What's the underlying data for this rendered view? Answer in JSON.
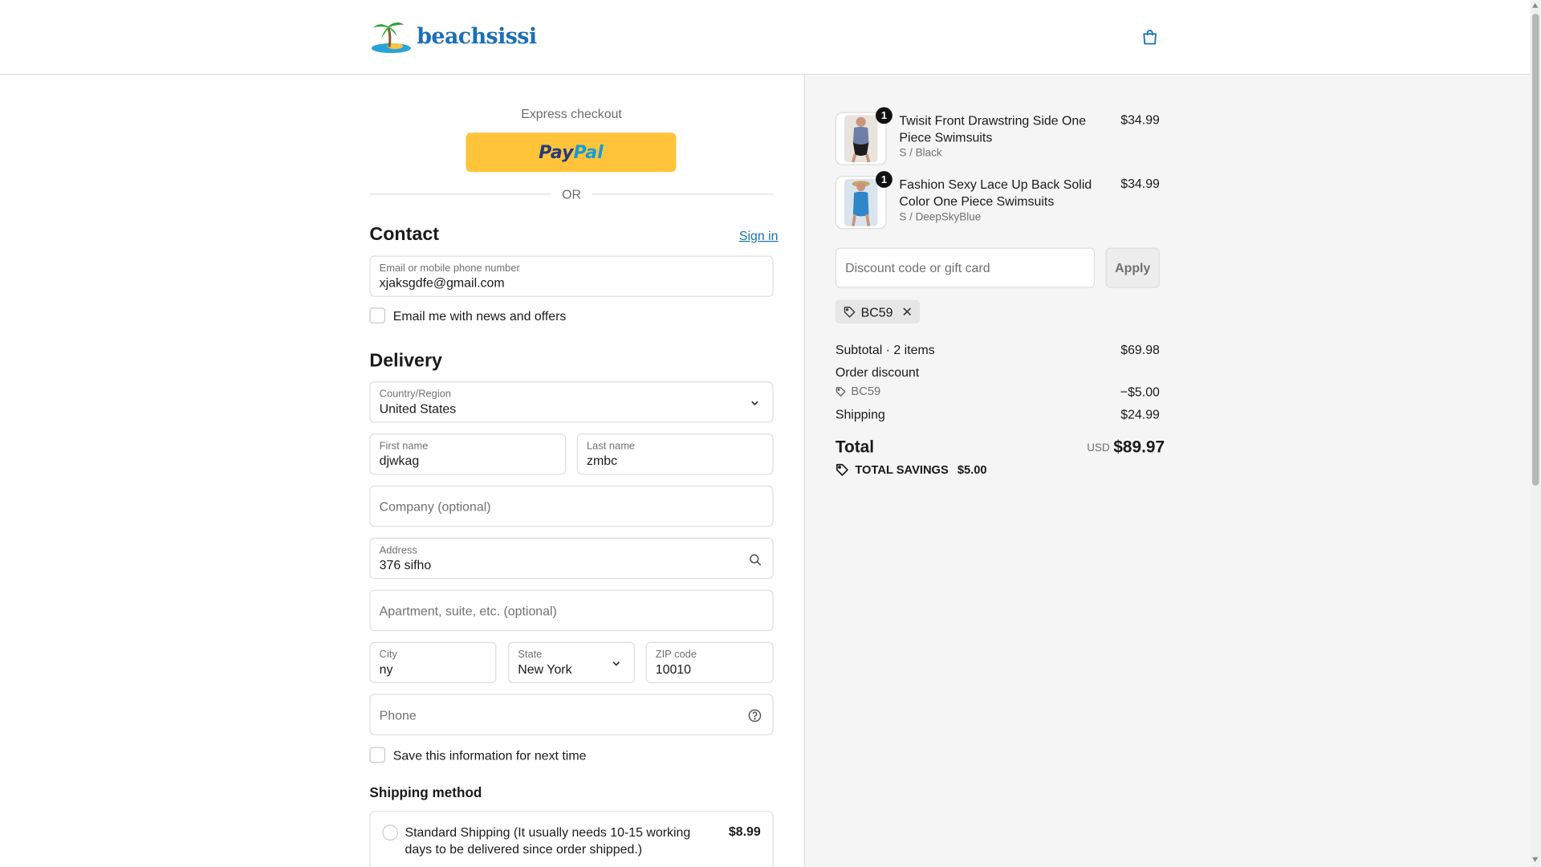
{
  "header": {
    "logo_text": "beachsissi",
    "cart_icon": "shopping-bag-icon"
  },
  "express": {
    "label": "Express checkout",
    "paypal_pay": "Pay",
    "paypal_pal": "Pal",
    "or_text": "OR"
  },
  "contact": {
    "title": "Contact",
    "sign_in": "Sign in",
    "email_label": "Email or mobile phone number",
    "email_value": "xjaksgdfe@gmail.com",
    "news_checkbox": "Email me with news and offers"
  },
  "delivery": {
    "title": "Delivery",
    "country_label": "Country/Region",
    "country_value": "United States",
    "first_name_label": "First name",
    "first_name_value": "djwkag",
    "last_name_label": "Last name",
    "last_name_value": "zmbc",
    "company_placeholder": "Company (optional)",
    "address_label": "Address",
    "address_value": "376 sifho",
    "apartment_placeholder": "Apartment, suite, etc. (optional)",
    "city_label": "City",
    "city_value": "ny",
    "state_label": "State",
    "state_value": "New York",
    "zip_label": "ZIP code",
    "zip_value": "10010",
    "phone_placeholder": "Phone",
    "save_checkbox": "Save this information for next time"
  },
  "shipping_method": {
    "title": "Shipping method",
    "options": [
      {
        "label": "Standard Shipping (It usually needs 10-15 working days to be delivered since order shipped.)",
        "price": "$8.99"
      }
    ]
  },
  "cart": {
    "items": [
      {
        "qty": "1",
        "name": "Twisit Front Drawstring Side One Piece Swimsuits",
        "variant": "S / Black",
        "price": "$34.99"
      },
      {
        "qty": "1",
        "name": "Fashion Sexy Lace Up Back Solid Color One Piece Swimsuits",
        "variant": "S / DeepSkyBlue",
        "price": "$34.99"
      }
    ]
  },
  "discount": {
    "placeholder": "Discount code or gift card",
    "apply": "Apply",
    "applied_code": "BC59"
  },
  "summary": {
    "subtotal_label": "Subtotal · 2 items",
    "subtotal_value": "$69.98",
    "order_discount_label": "Order discount",
    "discount_code": "BC59",
    "discount_value": "−$5.00",
    "shipping_label": "Shipping",
    "shipping_value": "$24.99",
    "total_label": "Total",
    "currency": "USD",
    "total_value": "$89.97",
    "savings_label": "TOTAL SAVINGS",
    "savings_value": "$5.00"
  },
  "colors": {
    "accent": "#1773b0",
    "paypal_yellow": "#ffc439",
    "summary_bg": "#f5f5f5"
  }
}
